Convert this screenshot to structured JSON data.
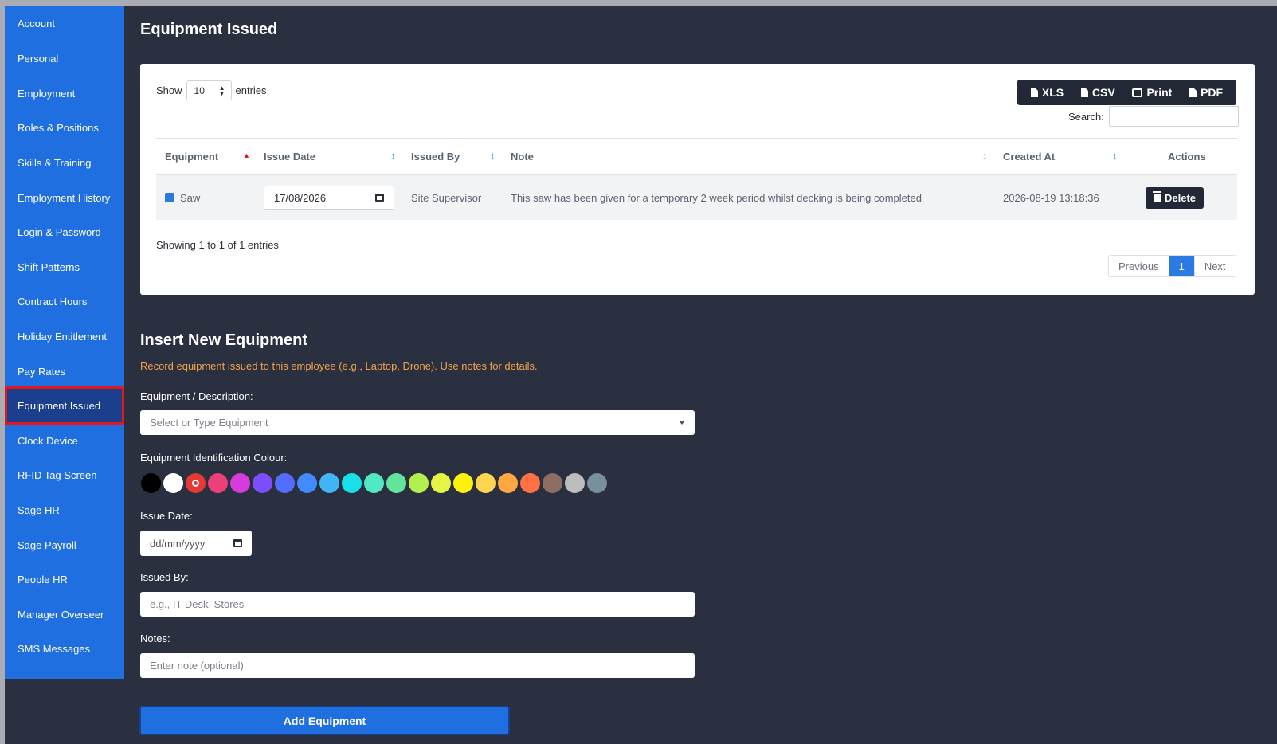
{
  "sidebar": {
    "items": [
      {
        "label": "Account"
      },
      {
        "label": "Personal"
      },
      {
        "label": "Employment"
      },
      {
        "label": "Roles & Positions"
      },
      {
        "label": "Skills & Training"
      },
      {
        "label": "Employment History"
      },
      {
        "label": "Login & Password"
      },
      {
        "label": "Shift Patterns"
      },
      {
        "label": "Contract Hours"
      },
      {
        "label": "Holiday Entitlement"
      },
      {
        "label": "Pay Rates"
      },
      {
        "label": "Equipment Issued"
      },
      {
        "label": "Clock Device"
      },
      {
        "label": "RFID Tag Screen"
      },
      {
        "label": "Sage HR"
      },
      {
        "label": "Sage Payroll"
      },
      {
        "label": "People HR"
      },
      {
        "label": "Manager Overseer"
      },
      {
        "label": "SMS Messages"
      }
    ],
    "active": "Equipment Issued"
  },
  "page": {
    "title": "Equipment Issued"
  },
  "table_controls": {
    "show_label": "Show",
    "entries_value": "10",
    "entries_label": "entries",
    "search_label": "Search:",
    "export": {
      "xls": "XLS",
      "csv": "CSV",
      "print": "Print",
      "pdf": "PDF"
    }
  },
  "table": {
    "headers": {
      "equipment": "Equipment",
      "issue_date": "Issue Date",
      "issued_by": "Issued By",
      "note": "Note",
      "created_at": "Created At",
      "actions": "Actions"
    },
    "rows": [
      {
        "equipment": "Saw",
        "color": "#2b7ae2",
        "issue_date": "17/08/2026",
        "issued_by": "Site Supervisor",
        "note": "This saw has been given for a temporary 2 week period whilst decking is being completed",
        "created_at": "2026-08-19 13:18:36",
        "action": "Delete"
      }
    ],
    "info": "Showing 1 to 1 of 1 entries",
    "pagination": {
      "previous": "Previous",
      "current": "1",
      "next": "Next"
    }
  },
  "form": {
    "title": "Insert New Equipment",
    "hint": "Record equipment issued to this employee (e.g., Laptop, Drone). Use notes for details.",
    "equipment_label": "Equipment / Description:",
    "equipment_placeholder": "Select or Type Equipment",
    "colour_label": "Equipment Identification Colour:",
    "colours": [
      "#000000",
      "#ffffff",
      "#e53935",
      "#ec407a",
      "#d63bdc",
      "#7c4dff",
      "#536dfe",
      "#448aff",
      "#40b4f5",
      "#18e0e8",
      "#52e8c4",
      "#62e59a",
      "#b2ef4f",
      "#e6f545",
      "#fdf20a",
      "#ffd54f",
      "#ffa740",
      "#ff7043",
      "#8d6e63",
      "#bdbdbd",
      "#78909c"
    ],
    "selected_colour_index": 2,
    "issue_date_label": "Issue Date:",
    "issue_date_placeholder": "dd/mm/yyyy",
    "issued_by_label": "Issued By:",
    "issued_by_placeholder": "e.g., IT Desk, Stores",
    "notes_label": "Notes:",
    "notes_placeholder": "Enter note (optional)",
    "submit": "Add Equipment"
  }
}
